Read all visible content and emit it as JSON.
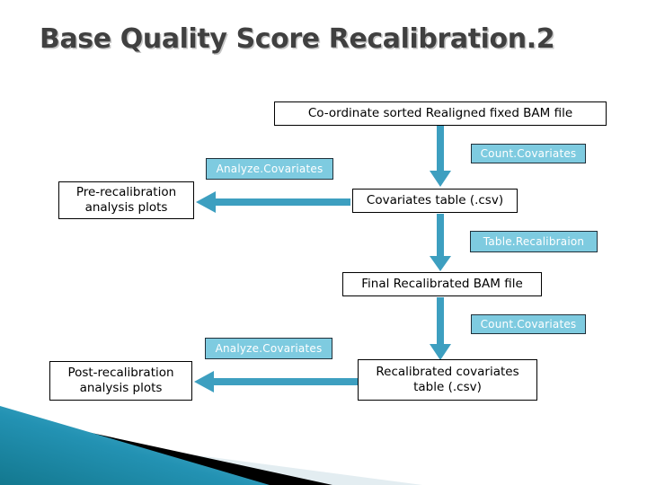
{
  "slide": {
    "title": "Base Quality Score Recalibration.2",
    "accent_color": "#3d9fc0",
    "label_fill": "#7ecbe0",
    "label_text_color": "#ffffff",
    "title_color": "#404040",
    "background": "#ffffff"
  },
  "nodes": [
    {
      "id": "input-bam",
      "label": "Co-ordinate sorted Realigned fixed BAM file"
    },
    {
      "id": "pre-plots",
      "label": "Pre-recalibration\nanalysis plots"
    },
    {
      "id": "covariates-table",
      "label": "Covariates table (.csv)"
    },
    {
      "id": "final-bam",
      "label": "Final Recalibrated BAM file"
    },
    {
      "id": "post-plots",
      "label": "Post-recalibration\nanalysis plots"
    },
    {
      "id": "recal-covariates-table",
      "label": "Recalibrated covariates\ntable (.csv)"
    }
  ],
  "node_text": {
    "input_bam": "Co-ordinate sorted Realigned fixed BAM file",
    "pre_plots_line1": "Pre-recalibration",
    "pre_plots_line2": "analysis plots",
    "covariates_table": "Covariates table (.csv)",
    "final_bam": "Final Recalibrated BAM file",
    "post_plots_line1": "Post-recalibration",
    "post_plots_line2": "analysis plots",
    "recal_table_line1": "Recalibrated covariates",
    "recal_table_line2": "table (.csv)"
  },
  "tool_labels": {
    "count_covariates_top": "Count.Covariates",
    "analyze_covariates_top": "Analyze.Covariates",
    "table_recalibration": "Table.Recalibraion",
    "count_covariates_bottom": "Count.Covariates",
    "analyze_covariates_bottom": "Analyze.Covariates"
  },
  "arrows": [
    {
      "id": "arrow-input-to-covariates",
      "direction": "down",
      "tool": "Count.Covariates"
    },
    {
      "id": "arrow-covariates-to-pre",
      "direction": "left",
      "tool": "Analyze.Covariates"
    },
    {
      "id": "arrow-covariates-to-final",
      "direction": "down",
      "tool": "Table.Recalibraion"
    },
    {
      "id": "arrow-final-to-recal",
      "direction": "down",
      "tool": "Count.Covariates"
    },
    {
      "id": "arrow-recal-to-post",
      "direction": "left",
      "tool": "Analyze.Covariates"
    }
  ],
  "decoration": {
    "name": "footer-triangles",
    "colors": {
      "teal_dark": "#1a7f9e",
      "teal_light": "#52b4d0",
      "black": "#000000",
      "pale": "#dde8ed"
    }
  }
}
